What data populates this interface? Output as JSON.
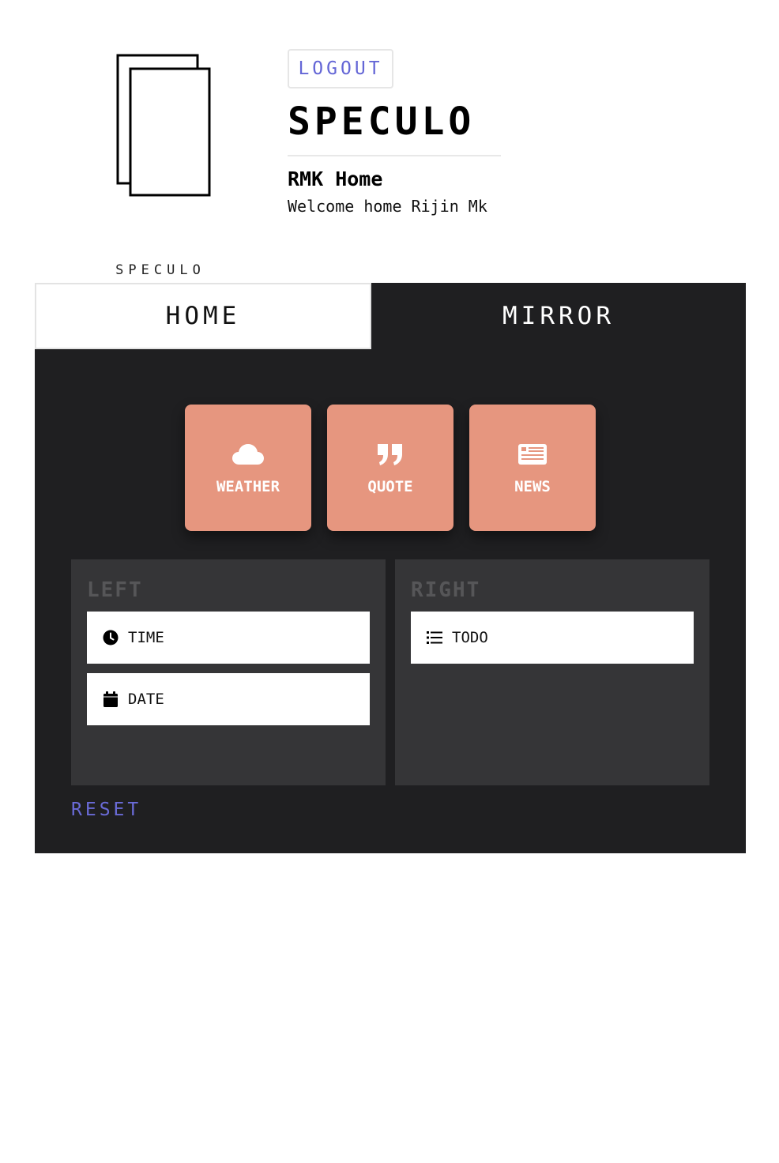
{
  "logo": {
    "text": "SPECULO",
    "icon": "speculo-logo-icon"
  },
  "header": {
    "logout_label": "LOGOUT",
    "title": "SPECULO",
    "home_name": "RMK Home",
    "welcome": "Welcome home Rijin Mk"
  },
  "tabs": [
    {
      "label": "HOME",
      "active": false
    },
    {
      "label": "MIRROR",
      "active": true
    }
  ],
  "tiles": [
    {
      "label": "WEATHER",
      "icon": "cloud-icon"
    },
    {
      "label": "QUOTE",
      "icon": "quote-icon"
    },
    {
      "label": "NEWS",
      "icon": "newspaper-icon"
    }
  ],
  "zones": {
    "left": {
      "title": "LEFT",
      "widgets": [
        {
          "label": "TIME",
          "icon": "clock-icon"
        },
        {
          "label": "DATE",
          "icon": "calendar-icon"
        }
      ]
    },
    "right": {
      "title": "RIGHT",
      "widgets": [
        {
          "label": "TODO",
          "icon": "list-icon"
        }
      ]
    }
  },
  "reset_label": "RESET",
  "colors": {
    "accent": "#6466d6",
    "tile": "#e6967f",
    "panel": "#1f1f21",
    "zone": "#353537"
  }
}
